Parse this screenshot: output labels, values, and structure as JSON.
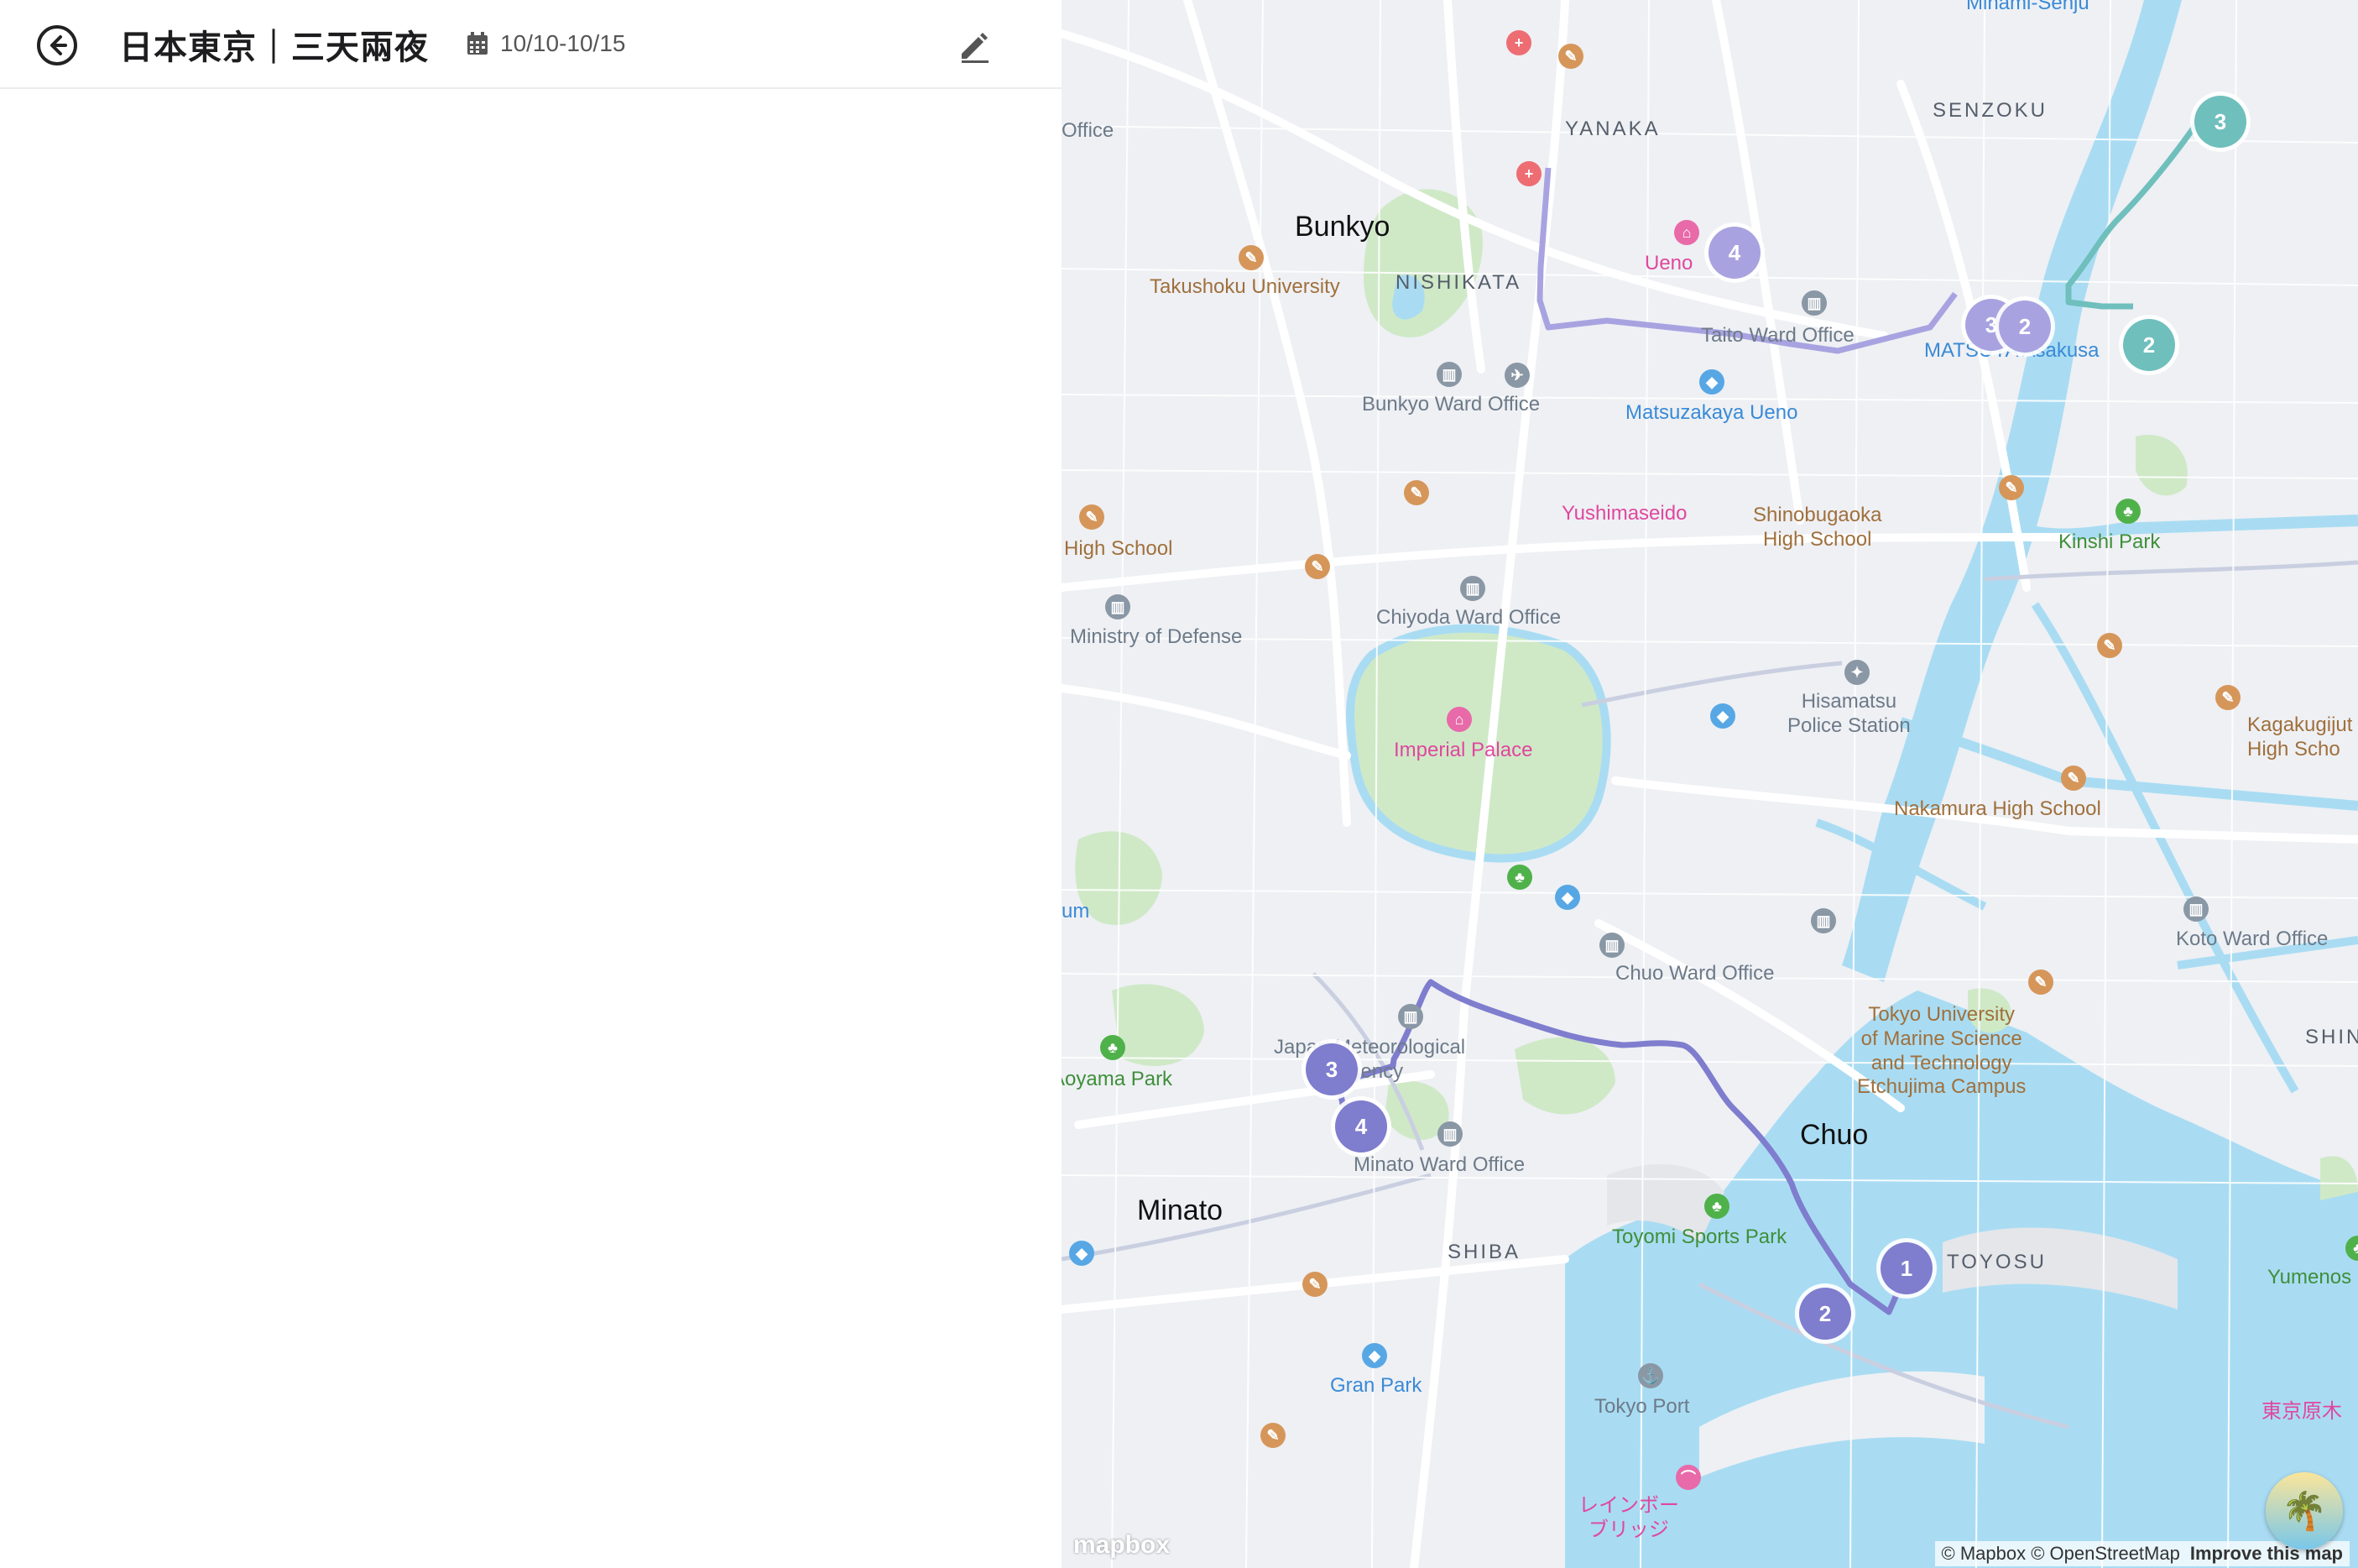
{
  "header": {
    "title": "日本東京｜三天兩夜",
    "dates": "10/10-10/15"
  },
  "map": {
    "districts": {
      "bunkyo": "Bunkyo",
      "chuo": "Chuo",
      "minato": "Minato",
      "yanaka": "YANAKA",
      "senzoku": "SENZOKU",
      "nishikata": "NISHIKATA",
      "shiba": "SHIBA",
      "toyosu": "TOYOSU",
      "shin": "SHIN"
    },
    "places": {
      "takushoku": "Takushoku University",
      "bunkyo_ward": "Bunkyo Ward Office",
      "matsuzakaya": "Matsuzakaya Ueno",
      "yushimaseido": "Yushimaseido",
      "shinobugaoka": "Shinobugaoka\nHigh School",
      "kinshi": "Kinshi Park",
      "high_school": "High School",
      "ministry": "Ministry of Defense",
      "chiyoda_ward": "Chiyoda Ward Office",
      "hisamatsu": "Hisamatsu\nPolice Station",
      "kagakugijutsu": "Kagakugijut\nHigh Scho",
      "nakamura": "Nakamura High School",
      "imperial": "Imperial Palace",
      "koto_ward": "Koto Ward Office",
      "chuo_ward": "Chuo Ward Office",
      "tokyo_univ": "Tokyo University\nof Marine Science\nand Technology\nEtchujima Campus",
      "jma": "Japan Meteorological\nAgency",
      "aoyama": "Aoyama Park",
      "minato_ward": "Minato Ward Office",
      "toyomi": "Toyomi Sports Park",
      "yumenoshima": "Yumenos",
      "gran_park": "Gran Park",
      "tokyo_port": "Tokyo Port",
      "rainbow": "レインボー\nブリッジ",
      "tokyo_kiba": "東京原木",
      "ueno": "Ueno",
      "taito_ward": "Taito Ward Office",
      "matsuya": "MATSUYA Asakusa",
      "minami_senju": "Minami-Senju",
      "museum": "um",
      "office": "Office"
    },
    "route_purple": [
      "1",
      "2",
      "3",
      "4"
    ],
    "route_lilac": [
      "4",
      "3",
      "2"
    ],
    "route_teal": [
      "3",
      "2"
    ],
    "attribution": "© Mapbox © OpenStreetMap",
    "improve": "Improve this map",
    "logo": "mapbox",
    "colors": {
      "route_purple": "#7f7dce",
      "route_lilac": "#a8a3e0",
      "route_teal": "#6fbfbd",
      "water": "#a9dcf3",
      "park": "#cfe9c7"
    }
  },
  "icons": {
    "back": "back-arrow-icon",
    "calendar": "calendar-icon",
    "edit": "pencil-edit-icon"
  }
}
